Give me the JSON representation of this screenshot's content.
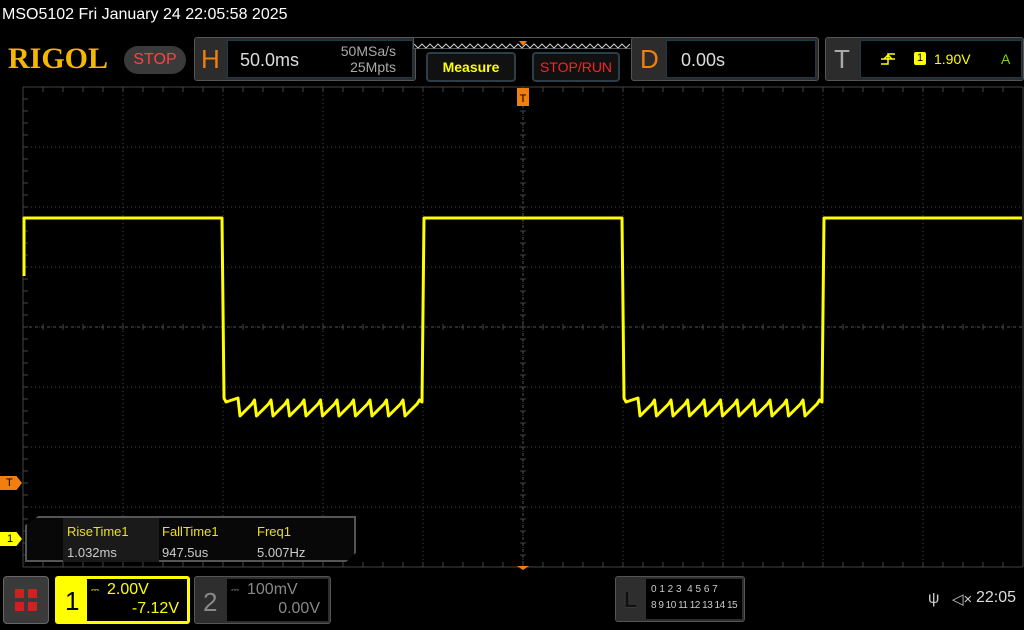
{
  "title": "MSO5102  Fri January 24 22:05:58 2025",
  "logo": "RIGOL",
  "run_state": "STOP",
  "horizontal": {
    "label": "H",
    "timebase": "50.0ms",
    "sample_rate": "50MSa/s",
    "memory_depth": "25Mpts"
  },
  "buttons": {
    "measure": "Measure",
    "stop_run": "STOP/RUN"
  },
  "delay": {
    "label": "D",
    "value": "0.00s"
  },
  "trigger": {
    "label": "T",
    "source": "1",
    "level": "1.90V",
    "mode": "A"
  },
  "markers": {
    "trigger": "T",
    "channel1": "1"
  },
  "measurements": [
    {
      "name": "RiseTime1",
      "value": "1.032ms"
    },
    {
      "name": "FallTime1",
      "value": "947.5us"
    },
    {
      "name": "Freq1",
      "value": "5.007Hz"
    }
  ],
  "channels": [
    {
      "number": "1",
      "scale": "2.00V",
      "offset": "-7.12V",
      "color": "#ffff00"
    },
    {
      "number": "2",
      "scale": "100mV",
      "offset": "0.00V",
      "color": "#888888"
    }
  ],
  "logic": {
    "label": "L",
    "row1": "0 1 2 3  4 5 6 7",
    "row2": "8 9 10 11 12 13 14 15"
  },
  "status": {
    "time": "22:05"
  },
  "waveform": {
    "frequency_hz": 5.007,
    "duty_percent": 50,
    "color": "#ffff00"
  }
}
